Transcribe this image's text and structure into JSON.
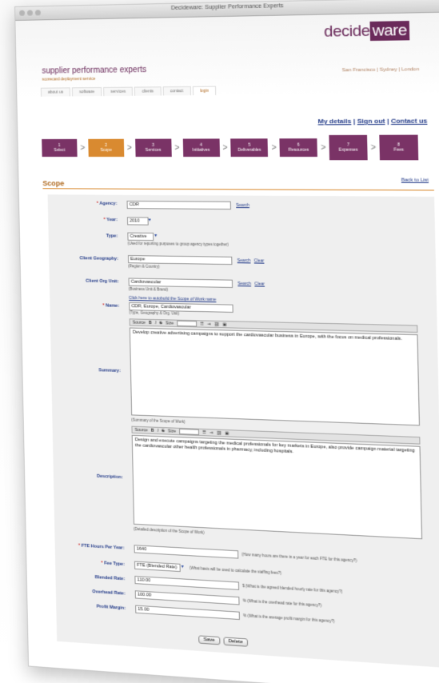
{
  "window": {
    "title": "Decideware: Supplier Performance Experts"
  },
  "header": {
    "logo_text": "decide",
    "logo_box": "ware",
    "brand": "supplier performance experts",
    "brand_sub": "scorecard deployment service",
    "cities": "San Francisco | Sydney | London",
    "tabs": [
      "about us",
      "software",
      "services",
      "clients",
      "contact",
      "login"
    ]
  },
  "top_links": {
    "details": "My details",
    "sep1": "|",
    "signout": "Sign out",
    "sep2": "|",
    "contact": "Contact us"
  },
  "steps": [
    {
      "num": "1",
      "label": "Select"
    },
    {
      "num": "2",
      "label": "Scope"
    },
    {
      "num": "3",
      "label": "Services"
    },
    {
      "num": "4",
      "label": "Initiatives"
    },
    {
      "num": "5",
      "label": "Deliverables"
    },
    {
      "num": "6",
      "label": "Resources"
    },
    {
      "num": "7",
      "label": "Expenses"
    },
    {
      "num": "8",
      "label": "Fees"
    }
  ],
  "page": {
    "title": "Scope",
    "back_link": "Back to List"
  },
  "form": {
    "agency": {
      "label": "Agency:",
      "value": "CDR",
      "search": "Search"
    },
    "year": {
      "label": "Year:",
      "value": "2010"
    },
    "type": {
      "label": "Type:",
      "value": "Creative",
      "hint": "(Used for reporting purposes to group agency types together)"
    },
    "geography": {
      "label": "Client Geography:",
      "value": "Europe",
      "search": "Search",
      "clear": "Clear",
      "hint": "(Region & Country)"
    },
    "orgunit": {
      "label": "Client Org Unit:",
      "value": "Cardiovascular",
      "search": "Search",
      "clear": "Clear",
      "hint": "(Business Unit & Brand)"
    },
    "name": {
      "label": "Name:",
      "autofill": "Click here to autobuild the Scope of Work name",
      "value": "CDR, Europe, Cardiovascular",
      "hint": "(Type, Geography & Org. Unit)"
    },
    "toolbar": {
      "source": "Source",
      "bold": "B",
      "italic": "I",
      "strike": "S",
      "size": "Size"
    },
    "summary": {
      "label": "Summary:",
      "value": "Develop creative advertising campaigns to support the cardiovascular business in Europe, with the focus on medical professionals.",
      "hint": "(Summary of the Scope of Work)"
    },
    "description": {
      "label": "Description:",
      "value": "Design and execute campaigns targeting the medical professionals for key markets in Europe, also provide campaign material targeting the cardiovascular other health professionals in pharmacy, including hospitals.",
      "hint": "(Detailed description of the Scope of Work)"
    },
    "fte_hours": {
      "label": "FTE Hours Per Year:",
      "value": "1640",
      "hint": "(How many hours are there in a year for each FTE for this agency?)"
    },
    "fee_type": {
      "label": "Fee Type:",
      "value": "FTE (Blended Rate)",
      "hint": "(What basis will be used to calculate the staffing fees?)"
    },
    "blended_rate": {
      "label": "Blended Rate:",
      "value": "110.00",
      "hint": "$ (What is the agreed blended hourly rate for this agency?)"
    },
    "overhead_rate": {
      "label": "Overhead Rate:",
      "value": "100.00",
      "hint": "% (What is the overhead rate for this agency?)"
    },
    "profit_margin": {
      "label": "Profit Margin:",
      "value": "15.00",
      "hint": "% (What is the average profit margin for this agency?)"
    }
  },
  "buttons": {
    "save": "Save",
    "delete": "Delete"
  },
  "required_mark": "*"
}
